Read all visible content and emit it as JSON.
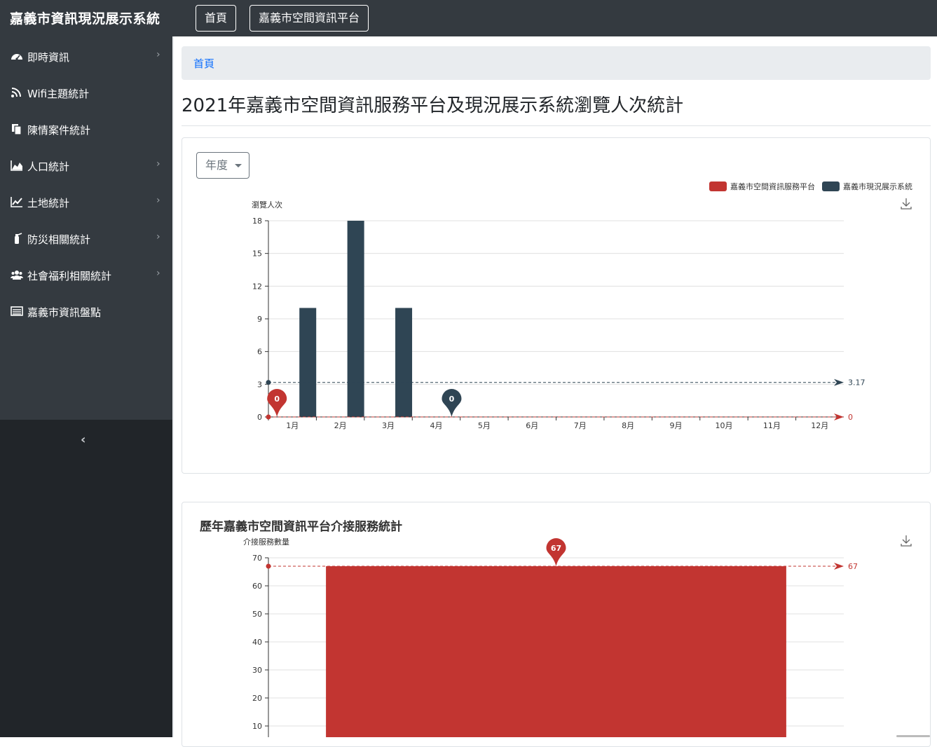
{
  "header": {
    "brand": "嘉義市資訊現況展示系統",
    "nav": [
      {
        "label": "首頁"
      },
      {
        "label": "嘉義市空間資訊平台"
      }
    ]
  },
  "sidebar": {
    "items": [
      {
        "label": "即時資訊",
        "icon": "dashboard-icon",
        "has_chevron": true
      },
      {
        "label": "Wifi主題統計",
        "icon": "rss-icon",
        "has_chevron": false
      },
      {
        "label": "陳情案件統計",
        "icon": "copy-icon",
        "has_chevron": false
      },
      {
        "label": "人口統計",
        "icon": "area-chart-icon",
        "has_chevron": true
      },
      {
        "label": "土地統計",
        "icon": "line-chart-icon",
        "has_chevron": true
      },
      {
        "label": "防災相關統計",
        "icon": "fire-extinguisher-icon",
        "has_chevron": true
      },
      {
        "label": "社會福利相關統計",
        "icon": "users-icon",
        "has_chevron": true
      },
      {
        "label": "嘉義市資訊盤點",
        "icon": "list-icon",
        "has_chevron": false
      }
    ],
    "toggle_glyph": "‹"
  },
  "breadcrumb": {
    "home": "首頁"
  },
  "page_title": "2021年嘉義市空間資訊服務平台及現況展示系統瀏覽人次統計",
  "filter": {
    "year_label": "年度"
  },
  "chart_data": [
    {
      "type": "bar",
      "title": "",
      "ylabel": "瀏覽人次",
      "xlabel": "",
      "ylim": [
        0,
        18
      ],
      "yticks": [
        0,
        3,
        6,
        9,
        12,
        15,
        18
      ],
      "categories": [
        "1月",
        "2月",
        "3月",
        "4月",
        "5月",
        "6月",
        "7月",
        "8月",
        "9月",
        "10月",
        "11月",
        "12月"
      ],
      "series": [
        {
          "name": "嘉義市空間資訊服務平台",
          "color": "#c23531",
          "values": [
            0,
            0,
            0,
            0,
            0,
            0,
            0,
            0,
            0,
            0,
            0,
            0
          ],
          "average": 0,
          "average_label": "0",
          "min_marker": {
            "category": "1月",
            "value": 0,
            "label": "0"
          }
        },
        {
          "name": "嘉義市現況展示系統",
          "color": "#2f4554",
          "values": [
            10,
            18,
            10,
            0,
            0,
            0,
            0,
            0,
            0,
            0,
            0,
            0
          ],
          "average": 3.17,
          "average_label": "3.17",
          "min_marker": {
            "category": "4月",
            "value": 0,
            "label": "0"
          }
        }
      ],
      "legend_position": "top-right",
      "grid": true
    },
    {
      "type": "bar",
      "title": "歷年嘉義市空間資訊平台介接服務統計",
      "ylabel": "介接服務數量",
      "xlabel": "",
      "ylim": [
        0,
        70
      ],
      "yticks": [
        10,
        20,
        30,
        40,
        50,
        60,
        70
      ],
      "categories": [
        ""
      ],
      "series": [
        {
          "name": "",
          "color": "#c23531",
          "values": [
            67
          ],
          "average": 67,
          "average_label": "67",
          "max_marker": {
            "value": 67,
            "label": "67"
          }
        }
      ],
      "grid": true
    }
  ]
}
